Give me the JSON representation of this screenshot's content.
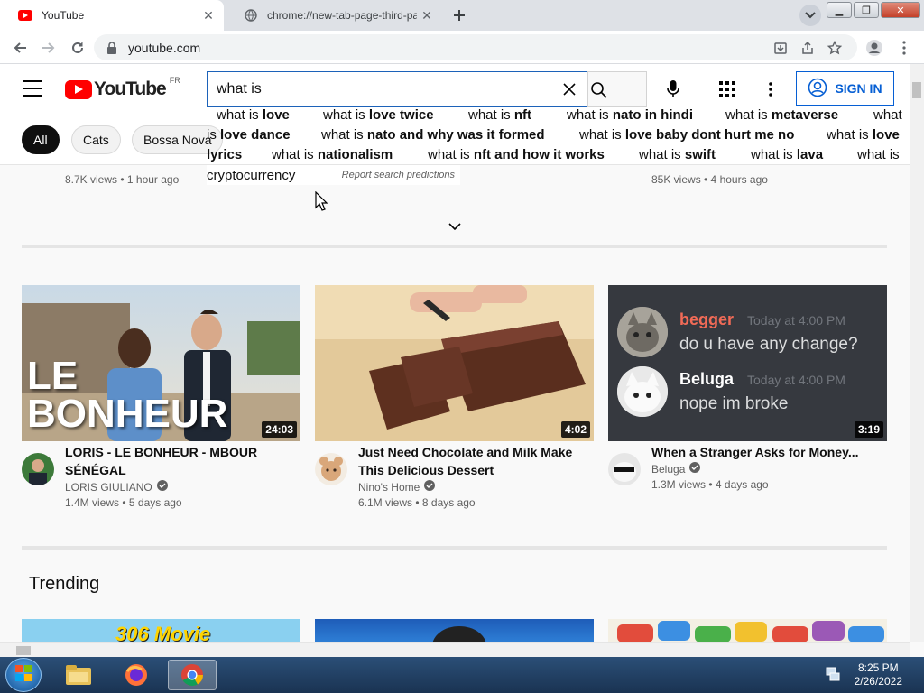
{
  "browser": {
    "tabs": [
      {
        "title": "YouTube",
        "active": true
      },
      {
        "title": "chrome://new-tab-page-third-pa",
        "active": false
      }
    ],
    "url": "youtube.com"
  },
  "youtube": {
    "logo_text": "YouTube",
    "country_code": "FR",
    "search_query": "what is",
    "sign_in": "SIGN IN",
    "chips": [
      "All",
      "Cats",
      "Bossa Nova"
    ],
    "suggestions": {
      "row1": [
        {
          "pre": "what is ",
          "bold": "love"
        },
        {
          "pre": "what is ",
          "bold": "love twice"
        },
        {
          "pre": "what is ",
          "bold": "nft"
        },
        {
          "pre": "what is ",
          "bold": "nato in hindi"
        },
        {
          "pre": "what is ",
          "bold": "metaverse"
        },
        {
          "pre": "what",
          "bold": ""
        }
      ],
      "row2": [
        {
          "pre": "is ",
          "bold": "love dance"
        },
        {
          "pre": "what is ",
          "bold": "nato and why was it formed"
        },
        {
          "pre": "what is ",
          "bold": "love baby dont hurt me no"
        },
        {
          "pre": "what is ",
          "bold": "love"
        }
      ],
      "row3": [
        {
          "pre": "",
          "bold": "lyrics"
        },
        {
          "pre": "what is ",
          "bold": "nationalism"
        },
        {
          "pre": "what is ",
          "bold": "nft and how it works"
        },
        {
          "pre": "what is ",
          "bold": "swift"
        },
        {
          "pre": "what is ",
          "bold": "lava"
        },
        {
          "pre": "what is",
          "bold": ""
        }
      ],
      "last": "cryptocurrency",
      "report": "Report search predictions"
    },
    "prev_row_meta": [
      "8.7K views • 1 hour ago",
      "85K views • 4 hours ago"
    ],
    "videos": [
      {
        "title": "LORIS - LE BONHEUR - MBOUR SÉNÉGAL",
        "channel": "LORIS GIULIANO",
        "verified": true,
        "stats": "1.4M views • 5 days ago",
        "duration": "24:03",
        "overlay": "LE BONHEUR"
      },
      {
        "title": "Just Need Chocolate and Milk Make This Delicious Dessert",
        "channel": "Nino's Home",
        "verified": true,
        "stats": "6.1M views • 8 days ago",
        "duration": "4:02"
      },
      {
        "title": "When a Stranger Asks for Money...",
        "channel": "Beluga",
        "verified": true,
        "stats": "1.3M views • 4 days ago",
        "duration": "3:19",
        "chat": [
          {
            "name": "begger",
            "time": "Today at 4:00 PM",
            "msg": "do u have any change?"
          },
          {
            "name": "Beluga",
            "time": "Today at 4:00 PM",
            "msg": "nope im broke"
          }
        ]
      }
    ],
    "trending_title": "Trending",
    "trending_thumb_text": "306 Movie"
  },
  "taskbar": {
    "time": "8:25 PM",
    "date": "2/26/2022"
  },
  "colors": {
    "yt_red": "#ff0000",
    "link_blue": "#065fd4",
    "search_border": "#1c62b9"
  }
}
